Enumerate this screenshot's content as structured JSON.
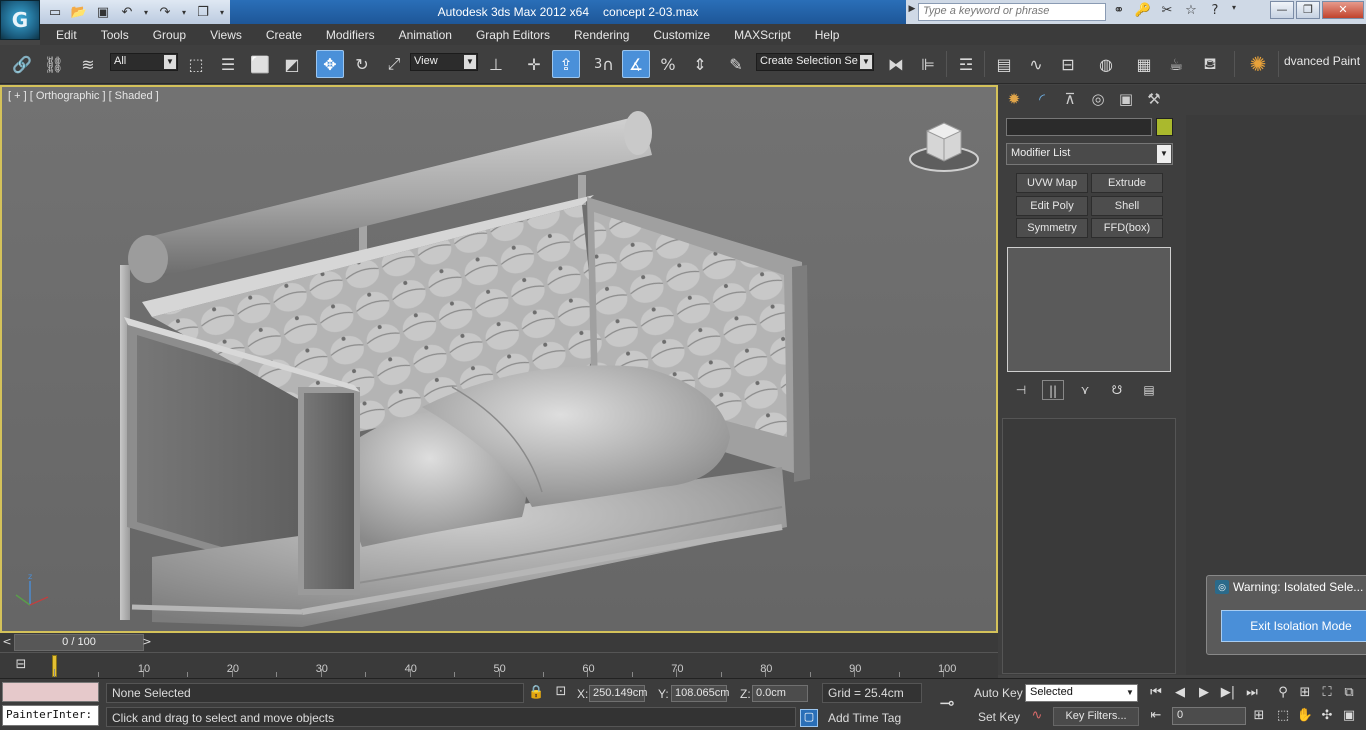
{
  "app": {
    "logo_letter": "G",
    "title": "Autodesk 3ds Max  2012 x64",
    "filename": "concept 2-03.max",
    "search_placeholder": "Type a keyword or phrase"
  },
  "menu": [
    "Edit",
    "Tools",
    "Group",
    "Views",
    "Create",
    "Modifiers",
    "Animation",
    "Graph Editors",
    "Rendering",
    "Customize",
    "MAXScript",
    "Help"
  ],
  "toolbar": {
    "selection_filter": "All",
    "reference_coord": "View",
    "named_selection": "Create Selection Se",
    "advanced_paint": "dvanced Paint",
    "snap_number": "3"
  },
  "viewport": {
    "label": "[ + ] [ Orthographic ] [ Shaded ]"
  },
  "command_panel": {
    "modifier_list": "Modifier List",
    "color_swatch": "#aab92d",
    "modifier_buttons": [
      "UVW Map",
      "Extrude",
      "Edit Poly",
      "Shell",
      "Symmetry",
      "FFD(box)"
    ]
  },
  "warning": {
    "title": "Warning: Isolated Sele...",
    "button": "Exit Isolation Mode"
  },
  "time_slider": {
    "label": "0 / 100",
    "prev": "<",
    "next": ">",
    "ticks": [
      "10",
      "20",
      "30",
      "40",
      "50",
      "60",
      "70",
      "80",
      "90",
      "100"
    ]
  },
  "status": {
    "maxscript_line": "PainterInter:",
    "selection": "None Selected",
    "prompt": "Click and drag to select and move objects",
    "x_label": "X:",
    "x_value": "250.149cm",
    "y_label": "Y:",
    "y_value": "108.065cm",
    "z_label": "Z:",
    "z_value": "0.0cm",
    "grid": "Grid = 25.4cm",
    "add_time_tag": "Add Time Tag",
    "auto_key": "Auto Key",
    "set_key": "Set Key",
    "key_mode": "Selected",
    "key_filters": "Key Filters...",
    "frame": "0"
  }
}
